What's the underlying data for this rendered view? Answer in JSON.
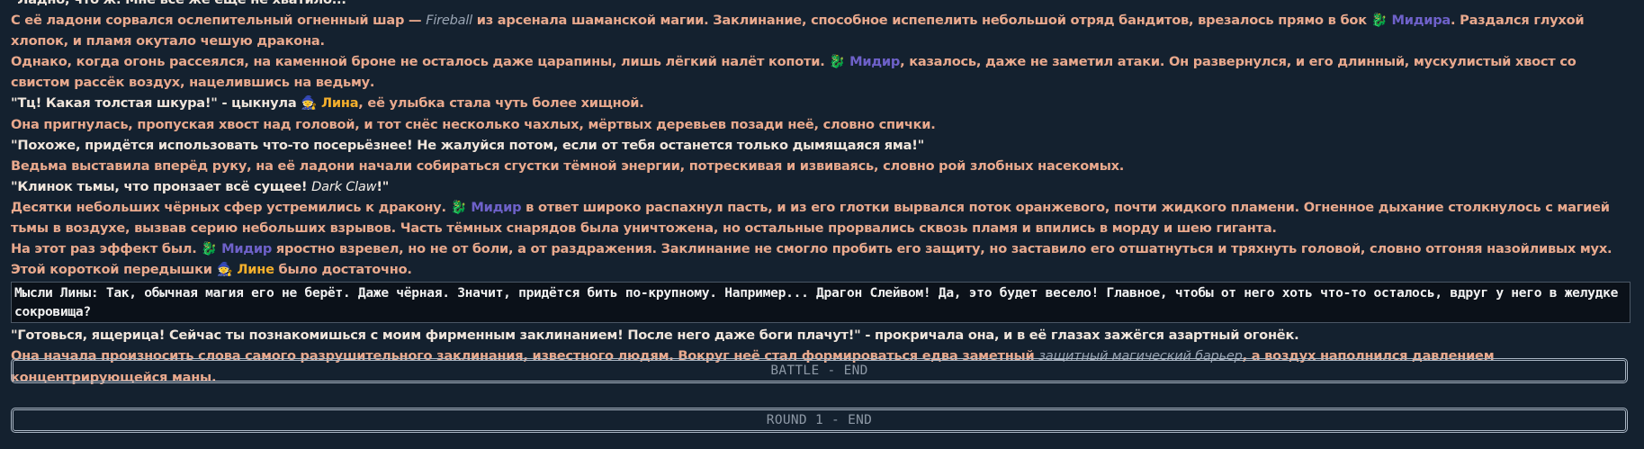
{
  "story": {
    "top_line": "\"Ладно, что ж. Мне всё же ещё не хватило...\"",
    "p1_a": "С её ладони сорвался ослепительный огненный шар — ",
    "p1_spell": "Fireball",
    "p1_b": " из арсенала шаманской магии. Заклинание, способное испепелить небольшой отряд бандитов, врезалось прямо в бок ",
    "p1_name": "Мидира",
    "p1_c": ". Раздался глухой хлопок, и пламя окутало чешую дракона.",
    "p2_a": "Однако, когда огонь рассеялся, на каменной броне не осталось даже царапины, лишь лёгкий налёт копоти. ",
    "p2_name": "Мидир",
    "p2_b": ", казалось, даже не заметил атаки. Он развернулся, и его длинный, мускулистый хвост со свистом рассёк воздух, нацелившись на ведьму.",
    "p3_a": "\"Тц! Какая толстая шкура!\" - цыкнула ",
    "p3_name": "Лина",
    "p3_b": ", её улыбка стала чуть более хищной.",
    "p4": "Она пригнулась, пропуская хвост над головой, и тот снёс несколько чахлых, мёртвых деревьев позади неё, словно спички.",
    "p5": "\"Похоже, придётся использовать что-то посерьёзнее! Не жалуйся потом, если от тебя останется только дымящаяся яма!\"",
    "p6": "Ведьма выставила вперёд руку, на её ладони начали собираться сгустки тёмной энергии, потрескивая и извиваясь, словно рой злобных насекомых.",
    "p7_a": "\"Клинок тьмы, что пронзает всё сущее! ",
    "p7_spell": "Dark Claw",
    "p7_b": "!\"",
    "p8_a": "Десятки небольших чёрных сфер устремились к дракону. ",
    "p8_name": "Мидир",
    "p8_b": " в ответ широко распахнул пасть, и из его глотки вырвался поток оранжевого, почти жидкого пламени. Огненное дыхание столкнулось с магией тьмы в воздухе, вызвав серию небольших взрывов. Часть тёмных снарядов была уничтожена, но остальные прорвались сквозь пламя и впились в морду и шею гиганта.",
    "p9_a": "На этот раз эффект был. ",
    "p9_name": "Мидир",
    "p9_b": " яростно взревел, но не от боли, а от раздражения. Заклинание не смогло пробить его защиту, но заставило его отшатнуться и тряхнуть головой, словно отгоняя назойливых мух. Этой короткой передышки ",
    "p9_name2": "Лине",
    "p9_c": " было достаточно.",
    "thought": "Мысли Лины: Так, обычная магия его не берёт. Даже чёрная. Значит, придётся бить по-крупному. Например... Драгон Слейвом! Да, это будет весело! Главное, чтобы от него хоть что-то осталось, вдруг у него в желудке сокровища?",
    "p10": "\"Готовься, ящерица! Сейчас ты познакомишься с моим фирменным заклинанием! После него даже боги плачут!\" - прокричала она, и в её глазах зажёгся азартный огонёк.",
    "p11_a": "Она начала произносить слова самого разрушительного заклинания, известного людям. Вокруг неё стал формироваться едва заметный ",
    "p11_spell": "защитный магический барьер",
    "p11_b": ", а воздух наполнился давлением концентрирующейся маны."
  },
  "emoji": {
    "dragon": "🐉",
    "witch": "🧙"
  },
  "dividers": {
    "battle_end": "BATTLE - END",
    "round_end": "ROUND 1 - END"
  },
  "colors": {
    "background": "#14212f",
    "narration": "#e9a98d",
    "midir": "#6e61c9",
    "lina": "#f5b02c"
  }
}
